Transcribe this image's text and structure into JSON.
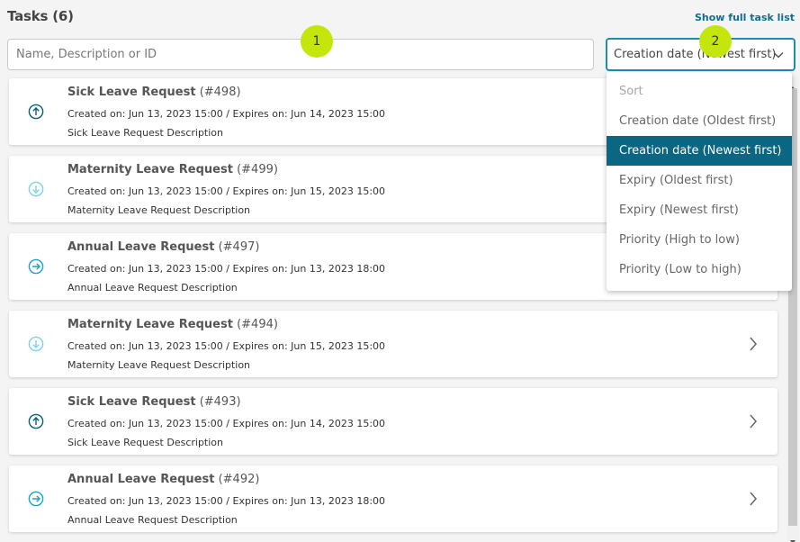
{
  "header": {
    "title": "Tasks (6)",
    "show_full_label": "Show full task list"
  },
  "search": {
    "placeholder": "Name, Description or ID",
    "value": ""
  },
  "sort": {
    "selected": "Creation date (Newest first)",
    "options": [
      {
        "label": "Sort",
        "header": true
      },
      {
        "label": "Creation date (Oldest first)"
      },
      {
        "label": "Creation date (Newest first)",
        "selected": true
      },
      {
        "label": "Expiry (Oldest first)"
      },
      {
        "label": "Expiry (Newest first)"
      },
      {
        "label": "Priority (High to low)"
      },
      {
        "label": "Priority (Low to high)"
      }
    ]
  },
  "badges": {
    "one": "1",
    "two": "2"
  },
  "tasks": [
    {
      "title": "Sick Leave Request",
      "id": "(#498)",
      "dates": "Created on: Jun 13, 2023 15:00 / Expires on: Jun 14, 2023 15:00",
      "description": "Sick Leave Request Description",
      "priority_icon": "arrow-up-circle-icon"
    },
    {
      "title": "Maternity Leave Request",
      "id": "(#499)",
      "dates": "Created on: Jun 13, 2023 15:00 / Expires on: Jun 15, 2023 15:00",
      "description": "Maternity Leave Request Description",
      "priority_icon": "arrow-down-circle-icon"
    },
    {
      "title": "Annual Leave Request",
      "id": "(#497)",
      "dates": "Created on: Jun 13, 2023 15:00 / Expires on: Jun 13, 2023 18:00",
      "description": "Annual Leave Request Description",
      "priority_icon": "arrow-right-circle-icon"
    },
    {
      "title": "Maternity Leave Request",
      "id": "(#494)",
      "dates": "Created on: Jun 13, 2023 15:00 / Expires on: Jun 15, 2023 15:00",
      "description": "Maternity Leave Request Description",
      "priority_icon": "arrow-down-circle-icon"
    },
    {
      "title": "Sick Leave Request",
      "id": "(#493)",
      "dates": "Created on: Jun 13, 2023 15:00 / Expires on: Jun 14, 2023 15:00",
      "description": "Sick Leave Request Description",
      "priority_icon": "arrow-up-circle-icon"
    },
    {
      "title": "Annual Leave Request",
      "id": "(#492)",
      "dates": "Created on: Jun 13, 2023 15:00 / Expires on: Jun 13, 2023 18:00",
      "description": "Annual Leave Request Description",
      "priority_icon": "arrow-right-circle-icon"
    }
  ],
  "colors": {
    "accent": "#0b6683",
    "link": "#0f6e8d",
    "focus_border": "#1d8cb0",
    "badge": "#c4e60d",
    "priority_high": "#0b5f79",
    "priority_medium": "#1aa3c4",
    "priority_low": "#7fd0e2"
  }
}
